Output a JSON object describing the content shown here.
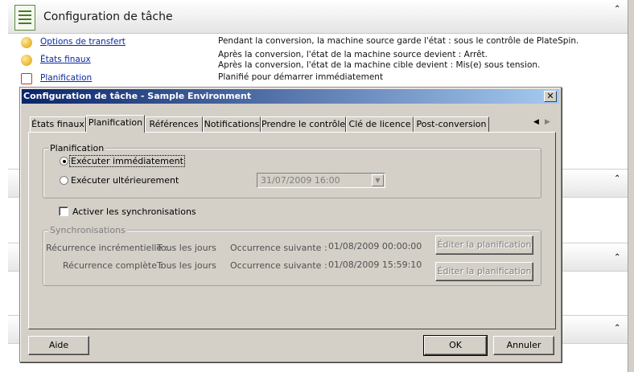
{
  "background": {
    "header_title": "Configuration de tâche",
    "rows": [
      {
        "link": "Options de transfert",
        "desc": "Pendant la conversion, la machine source garde l'état : sous le contrôle de PlateSpin."
      },
      {
        "link": "États finaux",
        "desc_line1": "Après la conversion, l'état de la machine source devient : Arrêt.",
        "desc_line2": "Après la conversion, l'état de la machine cible devient : Mis(e) sous tension."
      },
      {
        "link": "Planification",
        "desc": "Planifié pour démarrer immédiatement"
      }
    ],
    "collapse_glyph": "⌃"
  },
  "dialog": {
    "title": "Configuration de tâche - Sample Environment",
    "close_glyph": "✕",
    "tabs": [
      "États finaux",
      "Planification",
      "Références",
      "Notifications",
      "Prendre le contrôle",
      "Clé de licence",
      "Post-conversion"
    ],
    "active_tab": "Planification",
    "tab_scroll_left": "◀",
    "tab_scroll_right": "▶",
    "schedule_group": {
      "label": "Planification",
      "run_now": "Exécuter immédiatement",
      "run_later": "Exécuter ultérieurement",
      "date_value": "31/07/2009 16:00",
      "date_dropdown_glyph": "▼"
    },
    "enable_sync_label": "Activer les synchronisations",
    "sync_group": {
      "label": "Synchronisations",
      "incremental": {
        "label": "Récurrence incrémentielle :",
        "value": "Tous les jours",
        "next_label": "Occurrence suivante :",
        "next_value": "01/08/2009 00:00:00",
        "button": "Éditer la planification"
      },
      "full": {
        "label": "Récurrence complète :",
        "value": "Tous les jours",
        "next_label": "Occurrence suivante :",
        "next_value": "01/08/2009 15:59:10",
        "button": "Éditer la planification"
      }
    },
    "buttons": {
      "help": "Aide",
      "ok": "OK",
      "cancel": "Annuler"
    }
  }
}
